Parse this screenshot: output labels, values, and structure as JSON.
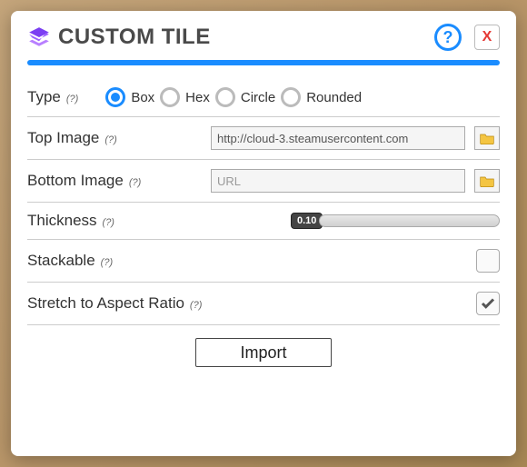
{
  "window": {
    "title": "CUSTOM TILE",
    "help_symbol": "?",
    "close_symbol": "X"
  },
  "type_row": {
    "label": "Type",
    "hint": "(?)",
    "options": [
      "Box",
      "Hex",
      "Circle",
      "Rounded"
    ],
    "selected": "Box"
  },
  "top_image": {
    "label": "Top Image",
    "hint": "(?)",
    "value": "http://cloud-3.steamusercontent.com",
    "placeholder": "URL"
  },
  "bottom_image": {
    "label": "Bottom Image",
    "hint": "(?)",
    "value": "",
    "placeholder": "URL"
  },
  "thickness": {
    "label": "Thickness",
    "hint": "(?)",
    "value": "0.10"
  },
  "stackable": {
    "label": "Stackable",
    "hint": "(?)",
    "checked": false
  },
  "stretch": {
    "label": "Stretch to Aspect Ratio",
    "hint": "(?)",
    "checked": true
  },
  "import_label": "Import",
  "colors": {
    "accent": "#1a8cff",
    "close": "#e53935"
  }
}
